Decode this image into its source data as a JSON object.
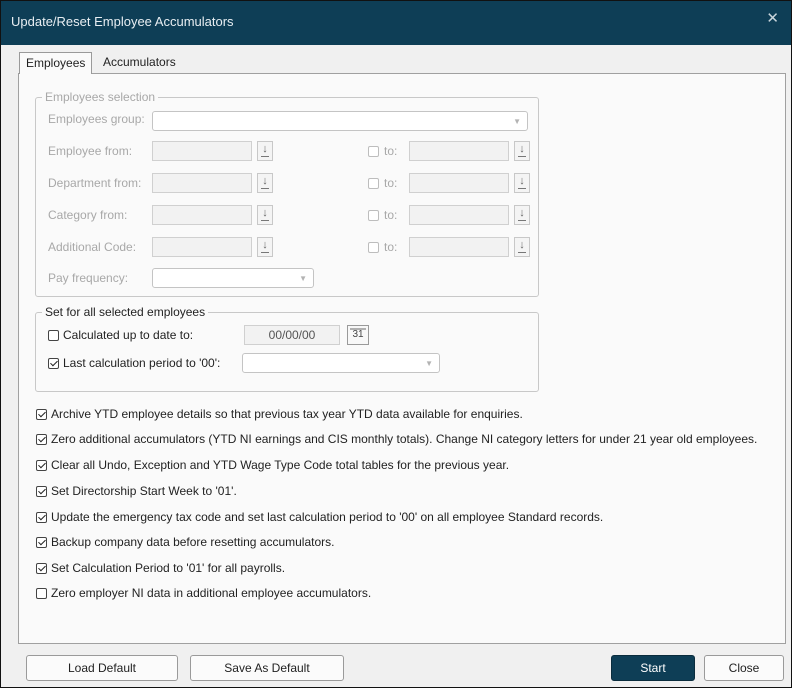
{
  "window": {
    "title": "Update/Reset Employee Accumulators",
    "close_glyph": "✕"
  },
  "tabs": [
    {
      "label": "Employees"
    },
    {
      "label": "Accumulators"
    }
  ],
  "employees_selection": {
    "legend": "Employees selection",
    "group_label": "Employees group:",
    "employee_from": "Employee from:",
    "department_from": "Department from:",
    "category_from": "Category from:",
    "additional_code": "Additional Code:",
    "pay_frequency": "Pay frequency:",
    "to_label": "to:"
  },
  "set_all": {
    "legend": "Set for all selected employees",
    "calc_up_to_label": "Calculated up to date to:",
    "calc_up_to_checked": false,
    "date_value": "00/00/00",
    "calendar_glyph": "31",
    "last_calc_label": "Last calculation period to '00':",
    "last_calc_checked": true
  },
  "options": [
    {
      "label": "Archive YTD employee details so that previous tax year YTD data available for enquiries.",
      "checked": true
    },
    {
      "label": "Zero additional accumulators (YTD NI earnings and CIS monthly totals). Change NI category letters for under 21 year old employees.",
      "checked": true
    },
    {
      "label": "Clear all Undo, Exception and YTD Wage Type Code total tables for the previous year.",
      "checked": true
    },
    {
      "label": "Set Directorship Start Week to '01'.",
      "checked": true
    },
    {
      "label": "Update the emergency tax code and set last calculation period to '00' on all employee Standard records.",
      "checked": true
    },
    {
      "label": "Backup company data before resetting accumulators.",
      "checked": true
    },
    {
      "label": "Set Calculation Period to '01' for all payrolls.",
      "checked": true
    },
    {
      "label": "Zero employer NI data in additional employee accumulators.",
      "checked": false
    }
  ],
  "buttons": {
    "load_default": "Load Default",
    "save_default": "Save As Default",
    "start": "Start",
    "close": "Close"
  },
  "colors": {
    "titlebar": "#0e3e56",
    "primary_button": "#0e3e56"
  }
}
